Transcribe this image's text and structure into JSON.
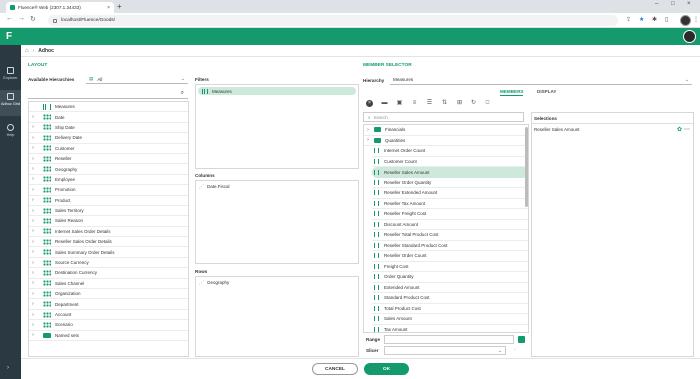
{
  "browser": {
    "tab_title": "Fluence® Web (2307.1.34433)",
    "url": "localhost/Fluence/Goods/",
    "new_tab": "+",
    "close": "×",
    "minimize": "–",
    "maximize": "□"
  },
  "app": {
    "logo": "F",
    "nav": [
      {
        "label": "Explorer",
        "icon": "explorer-icon"
      },
      {
        "label": "Adhoc Grid",
        "icon": "grid-icon"
      },
      {
        "label": "Help",
        "icon": "help-icon"
      }
    ],
    "collapse": "›"
  },
  "breadcrumb": {
    "home": "⌂",
    "sep": "›",
    "current": "Adhoc"
  },
  "layout": {
    "section_title": "LAYOUT",
    "available_label": "Available Hierarchies",
    "filter_value": "All",
    "hierarchies": [
      {
        "label": "Measures",
        "type": "measure",
        "expandable": false
      },
      {
        "label": "Date",
        "type": "dim",
        "expandable": true
      },
      {
        "label": "Ship Date",
        "type": "dim",
        "expandable": true
      },
      {
        "label": "Delivery Date",
        "type": "dim",
        "expandable": true
      },
      {
        "label": "Customer",
        "type": "dim",
        "expandable": true
      },
      {
        "label": "Reseller",
        "type": "dim",
        "expandable": true
      },
      {
        "label": "Geography",
        "type": "dim",
        "expandable": true
      },
      {
        "label": "Employee",
        "type": "dim",
        "expandable": true
      },
      {
        "label": "Promotion",
        "type": "dim",
        "expandable": true
      },
      {
        "label": "Product",
        "type": "dim",
        "expandable": true
      },
      {
        "label": "Sales Territory",
        "type": "dim",
        "expandable": true
      },
      {
        "label": "Sales Reason",
        "type": "dim",
        "expandable": true
      },
      {
        "label": "Internet Sales Order Details",
        "type": "dim",
        "expandable": true
      },
      {
        "label": "Reseller Sales Order Details",
        "type": "dim",
        "expandable": true
      },
      {
        "label": "Sales Summary Order Details",
        "type": "dim",
        "expandable": true
      },
      {
        "label": "Source Currency",
        "type": "dim",
        "expandable": true
      },
      {
        "label": "Destination Currency",
        "type": "dim",
        "expandable": true
      },
      {
        "label": "Sales Channel",
        "type": "dim",
        "expandable": true
      },
      {
        "label": "Organization",
        "type": "dim",
        "expandable": true
      },
      {
        "label": "Department",
        "type": "dim",
        "expandable": true
      },
      {
        "label": "Account",
        "type": "dim",
        "expandable": true
      },
      {
        "label": "Scenario",
        "type": "dim",
        "expandable": true
      },
      {
        "label": "Named sets",
        "type": "folder",
        "expandable": true
      }
    ],
    "filters_title": "Filters",
    "filters": [
      "Measures"
    ],
    "columns_title": "Columns",
    "columns": [
      "Date.Fiscal"
    ],
    "rows_title": "Rows",
    "rows": [
      "Geography"
    ]
  },
  "member_selector": {
    "section_title": "MEMBER SELECTOR",
    "hierarchy_label": "Hierarchy",
    "hierarchy_value": "Measures",
    "tabs": [
      "MEMBERS",
      "DISPLAY"
    ],
    "active_tab": "MEMBERS",
    "search_placeholder": "Search",
    "folders": [
      "Financials",
      "Quantities"
    ],
    "members": [
      "Internet Order Count",
      "Customer Count",
      "Reseller Sales Amount",
      "Reseller Order Quantity",
      "Reseller Extended Amount",
      "Reseller Tax Amount",
      "Reseller Freight Cost",
      "Discount Amount",
      "Reseller Total Product Cost",
      "Reseller Standard Product Cost",
      "Reseller Order Count",
      "Freight Cost",
      "Order Quantity",
      "Extended Amount",
      "Standard Product Cost",
      "Total Product Cost",
      "Sales Amount",
      "Tax Amount"
    ],
    "selected_member": "Reseller Sales Amount",
    "range_label": "Range",
    "slicer_label": "Slicer",
    "selections_title": "Selections",
    "selections": [
      "Reseller Sales Amount"
    ]
  },
  "footer": {
    "cancel": "CANCEL",
    "ok": "OK"
  },
  "colors": {
    "brand": "#159a6d",
    "nav": "#2b3a42",
    "highlight": "#cde9dc"
  }
}
